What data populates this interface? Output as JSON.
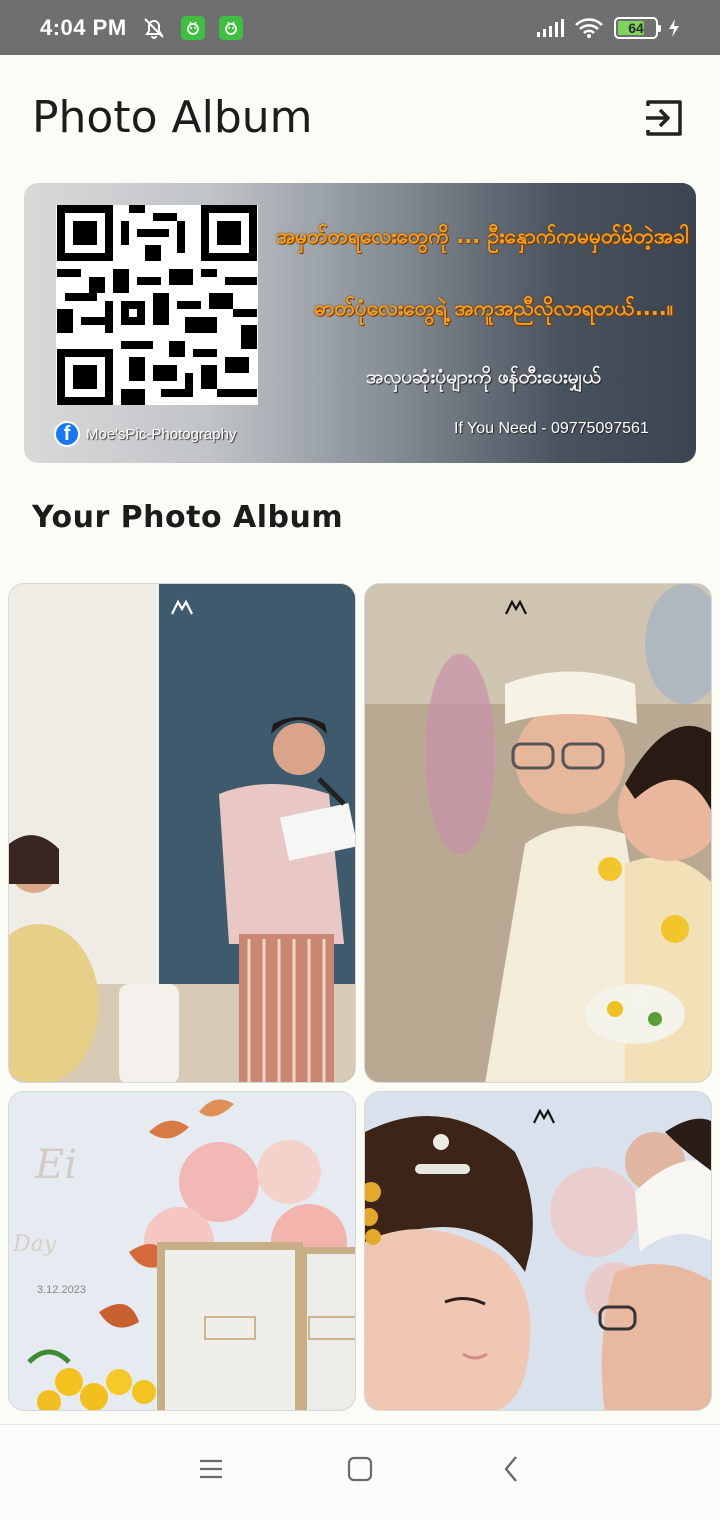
{
  "status_bar": {
    "time": "4:04 PM",
    "battery": "64",
    "icons": [
      "alarm-off-icon",
      "app-notification-icon",
      "app-notification-icon",
      "signal-icon",
      "wifi-icon",
      "battery-icon",
      "charging-icon"
    ]
  },
  "header": {
    "title": "Photo Album",
    "logout_icon": "logout-icon"
  },
  "banner": {
    "line1": "အမှတ်တရလေးတွေကို ... ဦးနှောက်ကမမှတ်မိတဲ့အခါ",
    "line2": "ဓာတ်ပုံလေးတွေရဲ့ အကူအညီလိုလာရတယ်....။",
    "line3": "အလှပဆုံးပုံများကို ဖန်တီးပေးမျှယ်",
    "facebook_page": "Moe'sPic-Photography",
    "contact": "If You Need - 09775097561",
    "colors": {
      "accent_text": "#f5a21a",
      "facebook": "#1877f2"
    }
  },
  "section": {
    "title": "Your Photo Album"
  },
  "photos": [
    {
      "alt": "photo-1"
    },
    {
      "alt": "photo-2"
    },
    {
      "alt": "photo-3"
    },
    {
      "alt": "photo-4"
    }
  ],
  "photo_texts": {
    "card_script": "Ei",
    "card_day": "Day",
    "card_date": "3.12.2023"
  },
  "nav": {
    "menu_icon": "menu-icon",
    "home_icon": "home-icon",
    "back_icon": "back-icon"
  }
}
